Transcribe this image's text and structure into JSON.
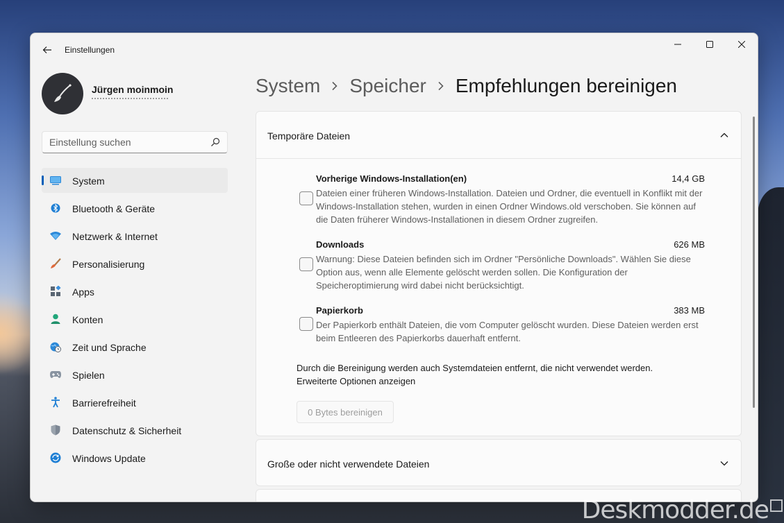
{
  "window": {
    "app_title": "Einstellungen"
  },
  "profile": {
    "name": "Jürgen moinmoin"
  },
  "search": {
    "placeholder": "Einstellung suchen"
  },
  "sidebar": {
    "items": [
      {
        "label": "System",
        "icon": "system-icon",
        "active": true
      },
      {
        "label": "Bluetooth & Geräte",
        "icon": "bluetooth-icon"
      },
      {
        "label": "Netzwerk & Internet",
        "icon": "wifi-icon"
      },
      {
        "label": "Personalisierung",
        "icon": "brush-icon"
      },
      {
        "label": "Apps",
        "icon": "apps-icon"
      },
      {
        "label": "Konten",
        "icon": "account-icon"
      },
      {
        "label": "Zeit und Sprache",
        "icon": "globe-clock-icon"
      },
      {
        "label": "Spielen",
        "icon": "gamepad-icon"
      },
      {
        "label": "Barrierefreiheit",
        "icon": "accessibility-icon"
      },
      {
        "label": "Datenschutz & Sicherheit",
        "icon": "shield-icon"
      },
      {
        "label": "Windows Update",
        "icon": "update-icon"
      }
    ]
  },
  "breadcrumb": {
    "items": [
      "System",
      "Speicher",
      "Empfehlungen bereinigen"
    ]
  },
  "temp_files": {
    "title": "Temporäre Dateien",
    "entries": [
      {
        "title": "Vorherige Windows-Installation(en)",
        "size": "14,4 GB",
        "description": "Dateien einer früheren Windows-Installation. Dateien und Ordner, die eventuell in Konflikt mit der Windows-Installation stehen, wurden in einen Ordner Windows.old verschoben. Sie können auf die Daten früherer Windows-Installationen in diesem Ordner zugreifen.",
        "checked": false
      },
      {
        "title": "Downloads",
        "size": "626 MB",
        "description": "Warnung: Diese Dateien befinden sich im Ordner \"Persönliche Downloads\". Wählen Sie diese Option aus, wenn alle Elemente gelöscht werden sollen. Die Konfiguration der Speicheroptimierung wird dabei nicht berücksichtigt.",
        "checked": false
      },
      {
        "title": "Papierkorb",
        "size": "383 MB",
        "description": "Der Papierkorb enthält Dateien, die vom Computer gelöscht wurden. Diese Dateien werden erst beim Entleeren des Papierkorbs dauerhaft entfernt.",
        "checked": false
      }
    ],
    "notice": "Durch die Bereinigung werden auch Systemdateien entfernt, die nicht verwendet werden.",
    "advanced_link": "Erweiterte Optionen anzeigen",
    "clean_button": "0 Bytes bereinigen"
  },
  "large_files": {
    "title": "Große oder nicht verwendete Dateien"
  },
  "watermark": "Deskmodder.de",
  "colors": {
    "accent": "#005fb8",
    "window_bg": "#f3f3f3",
    "card_bg": "#fbfbfb"
  }
}
